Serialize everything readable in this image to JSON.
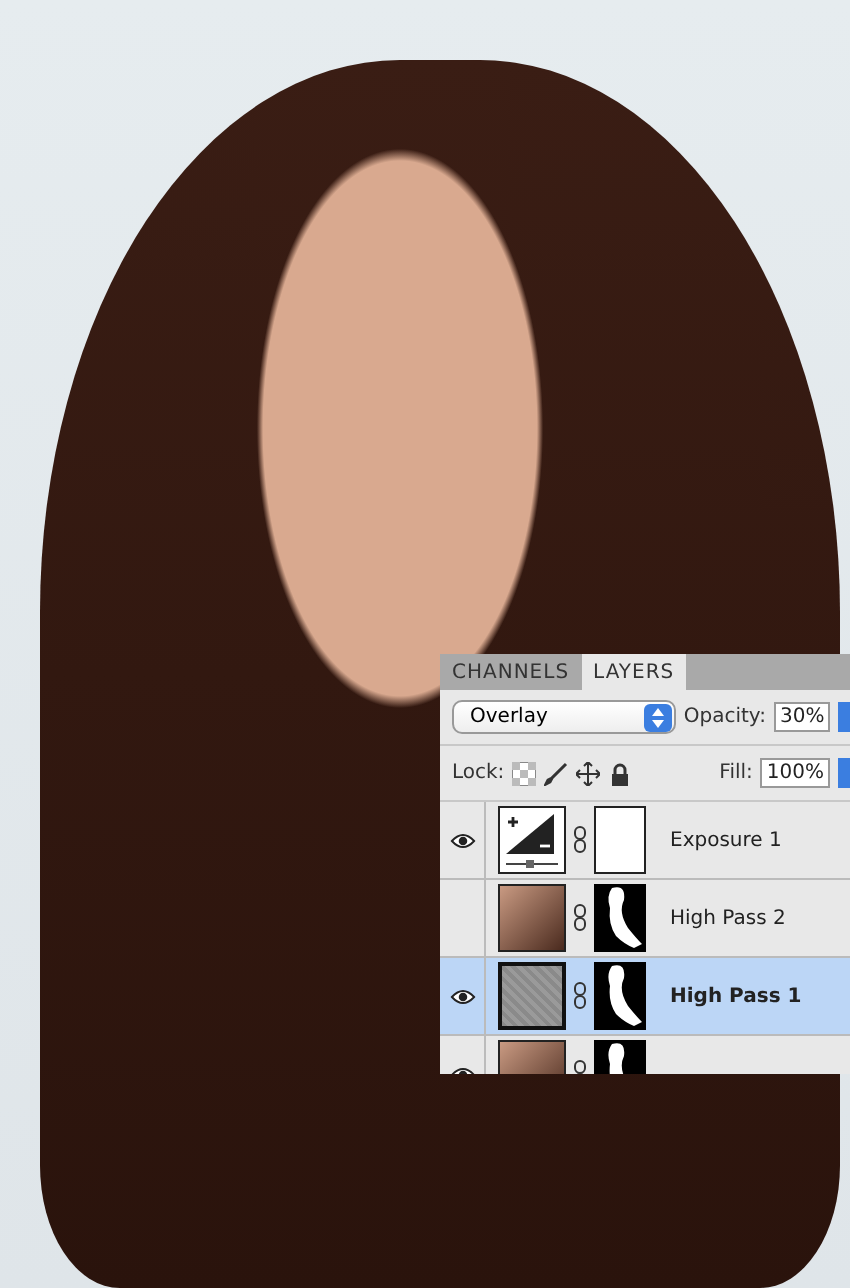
{
  "layers_panel": {
    "tabs": [
      {
        "label": "CHANNELS",
        "selected": false
      },
      {
        "label": "LAYERS",
        "selected": true
      }
    ],
    "blend_mode": "Overlay",
    "opacity": {
      "label": "Opacity:",
      "value": "30%"
    },
    "lock": {
      "label": "Lock:"
    },
    "fill": {
      "label": "Fill:",
      "value": "100%"
    },
    "layers": [
      {
        "name": "Exposure 1",
        "visible": true,
        "selected": false,
        "kind": "adjustment"
      },
      {
        "name": "High Pass 2",
        "visible": false,
        "selected": false,
        "kind": "photo"
      },
      {
        "name": "High Pass 1",
        "visible": true,
        "selected": true,
        "kind": "noise"
      },
      {
        "visible": true,
        "selected": false,
        "kind": "photo"
      }
    ]
  }
}
